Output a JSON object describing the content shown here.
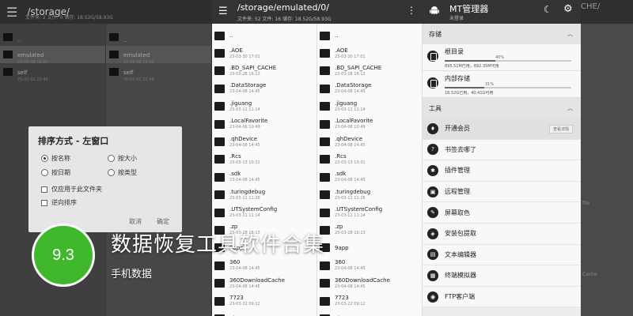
{
  "left_panel": {
    "path": "/storage/",
    "info": "文件夹: 2 文件: 0 储存: 18.52G/58.93G",
    "col1": [
      {
        "name": "..",
        "date": ""
      },
      {
        "name": "emulated",
        "date": "23-05-08 16:05"
      },
      {
        "name": "self",
        "date": "70-01-01 22:46"
      }
    ],
    "col2": [
      {
        "name": "..",
        "date": ""
      },
      {
        "name": "emulated",
        "date": "23-05-08 16:05"
      },
      {
        "name": "self",
        "date": "70-01-01 22:46"
      }
    ]
  },
  "dialog": {
    "title": "排序方式 - 左窗口",
    "by_name": "按名称",
    "by_size": "按大小",
    "by_date": "按日期",
    "by_type": "按类型",
    "only_folder": "仅应用于此文件夹",
    "reverse": "逆向排序",
    "cancel": "取消",
    "ok": "确定"
  },
  "overlay": {
    "score": "9.3",
    "title": "数据恢复工具软件合集",
    "subtitle": "手机数据"
  },
  "mid_panel": {
    "path": "/storage/emulated/0/",
    "info": "文件夹: 52 文件: 16 储存: 18.52G/58.93G",
    "col1": [
      {
        "name": "..",
        "date": ""
      },
      {
        "name": ".AOE",
        "date": "23-03-30 17:01"
      },
      {
        "name": ".BD_SAPI_CACHE",
        "date": "23-03-28 16:13"
      },
      {
        "name": ".DataStorage",
        "date": "23-04-08 14:45"
      },
      {
        "name": ".jiguang",
        "date": "23-03-11 11:14"
      },
      {
        "name": ".LocalFavorite",
        "date": "23-04-06 10:49"
      },
      {
        "name": ".qhDevice",
        "date": "23-04-08 14:45"
      },
      {
        "name": ".Rcs",
        "date": "23-03-13 10:31"
      },
      {
        "name": ".sdk",
        "date": "23-04-08 14:45"
      },
      {
        "name": ".turingdebug",
        "date": "23-03-11 11:26"
      },
      {
        "name": ".UTSystemConfig",
        "date": "23-03-11 11:14"
      },
      {
        "name": ".zp",
        "date": "23-03-28 16:13"
      },
      {
        "name": "9app",
        "date": ""
      },
      {
        "name": "360",
        "date": "23-04-08 14:45"
      },
      {
        "name": "360DownloadCache",
        "date": "23-04-08 14:45"
      },
      {
        "name": "7723",
        "date": "23-03-22 09:12"
      },
      {
        "name": "Alarms",
        "date": ""
      }
    ],
    "col2": [
      {
        "name": "..",
        "date": ""
      },
      {
        "name": ".AOE",
        "date": "23-03-30 17:01"
      },
      {
        "name": ".BD_SAPI_CACHE",
        "date": "23-03-28 16:13"
      },
      {
        "name": ".DataStorage",
        "date": "23-04-08 14:45"
      },
      {
        "name": ".jiguang",
        "date": "23-03-11 11:14"
      },
      {
        "name": ".LocalFavorite",
        "date": "23-04-06 10:49"
      },
      {
        "name": ".qhDevice",
        "date": "23-04-08 14:45"
      },
      {
        "name": ".Rcs",
        "date": "23-03-13 10:31"
      },
      {
        "name": ".sdk",
        "date": "23-04-08 14:45"
      },
      {
        "name": ".turingdebug",
        "date": "23-03-11 11:26"
      },
      {
        "name": ".UTSystemConfig",
        "date": "23-03-11 11:14"
      },
      {
        "name": ".zp",
        "date": "23-03-28 16:13"
      },
      {
        "name": "9app",
        "date": ""
      },
      {
        "name": "360",
        "date": "23-04-08 14:45"
      },
      {
        "name": "360DownloadCache",
        "date": "23-04-08 14:45"
      },
      {
        "name": "7723",
        "date": "23-03-22 09:12"
      },
      {
        "name": "Alarms",
        "date": ""
      }
    ]
  },
  "right_panel": {
    "app_name": "MT管理器",
    "login": "未登录",
    "storage_header": "存储",
    "root": {
      "name": "根目录",
      "percent_label": "40%",
      "percent": 40,
      "size": "895.51M已用，892.35M可用"
    },
    "internal": {
      "name": "内部存储",
      "percent_label": "31%",
      "percent": 31,
      "size": "18.52G已用，40.41G可用"
    },
    "tools_header": "工具",
    "tools": [
      {
        "name": "开通会员",
        "icon": "vip-icon",
        "glyph": "♦"
      },
      {
        "name": "书签去哪了",
        "icon": "question-icon",
        "glyph": "?"
      },
      {
        "name": "插件管理",
        "icon": "plugin-icon",
        "glyph": "✱"
      },
      {
        "name": "远程管理",
        "icon": "remote-icon",
        "glyph": "▣"
      },
      {
        "name": "屏幕取色",
        "icon": "color-picker-icon",
        "glyph": "✎"
      },
      {
        "name": "安装包提取",
        "icon": "package-icon",
        "glyph": "◈"
      },
      {
        "name": "文本编辑器",
        "icon": "text-editor-icon",
        "glyph": "▤"
      },
      {
        "name": "终端模拟器",
        "icon": "terminal-icon",
        "glyph": "▦"
      },
      {
        "name": "FTP客户端",
        "icon": "ftp-icon",
        "glyph": "◉"
      }
    ],
    "view_details": "查看详情"
  },
  "far_panel": {
    "fragment": "CHE/",
    "file": "file",
    "cache": "Cache"
  }
}
